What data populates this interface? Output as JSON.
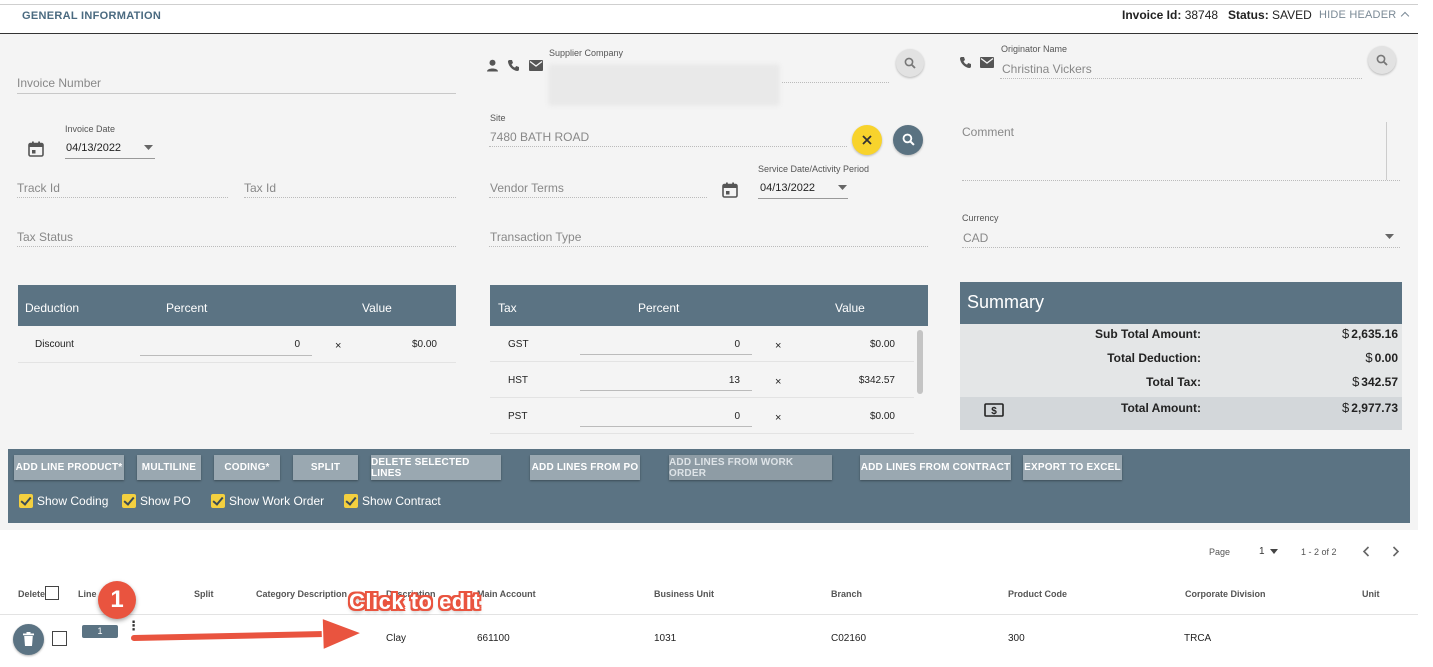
{
  "header": {
    "title": "GENERAL INFORMATION",
    "invoice_id_label": "Invoice Id",
    "invoice_id": "38748",
    "status_label": "Status",
    "status": "SAVED",
    "hide_header": "HIDE HEADER"
  },
  "form": {
    "invoice_number_label": "Invoice Number",
    "invoice_date_label": "Invoice Date",
    "invoice_date": "04/13/2022",
    "track_id_label": "Track Id",
    "tax_id_label": "Tax Id",
    "tax_status_label": "Tax Status",
    "supplier_company_label": "Supplier Company",
    "site_label": "Site",
    "site": "7480 BATH ROAD",
    "vendor_terms_label": "Vendor Terms",
    "service_date_label": "Service Date/Activity Period",
    "service_date": "04/13/2022",
    "transaction_type_label": "Transaction Type",
    "originator_name_label": "Originator Name",
    "originator_name": "Christina Vickers",
    "comment_label": "Comment",
    "currency_label": "Currency",
    "currency": "CAD"
  },
  "deduction_table": {
    "headers": [
      "Deduction",
      "Percent",
      "Value"
    ],
    "rows": [
      {
        "name": "Discount",
        "percent": "0",
        "value": "$0.00"
      }
    ]
  },
  "tax_table": {
    "headers": [
      "Tax",
      "Percent",
      "Value"
    ],
    "rows": [
      {
        "name": "GST",
        "percent": "0",
        "value": "$0.00"
      },
      {
        "name": "HST",
        "percent": "13",
        "value": "$342.57"
      },
      {
        "name": "PST",
        "percent": "0",
        "value": "$0.00"
      }
    ]
  },
  "summary": {
    "title": "Summary",
    "currency_symbol": "$",
    "rows": [
      {
        "label": "Sub Total Amount:",
        "value": "2,635.16"
      },
      {
        "label": "Total Deduction:",
        "value": "0.00"
      },
      {
        "label": "Total Tax:",
        "value": "342.57"
      },
      {
        "label": "Total Amount:",
        "value": "2,977.73"
      }
    ]
  },
  "toolbar": {
    "buttons": [
      "ADD LINE PRODUCT*",
      "MULTILINE",
      "CODING*",
      "SPLIT",
      "DELETE SELECTED LINES",
      "ADD LINES FROM PO",
      "ADD LINES FROM WORK ORDER",
      "ADD LINES FROM CONTRACT",
      "EXPORT TO EXCEL"
    ],
    "checkboxes": [
      "Show Coding",
      "Show PO",
      "Show Work Order",
      "Show Contract"
    ]
  },
  "pagination": {
    "page_label": "Page",
    "page": "1",
    "range": "1 - 2 of 2"
  },
  "grid": {
    "headers": [
      "Delete",
      "Line",
      "Split",
      "Category Description",
      "Description",
      "Main Account",
      "Business Unit",
      "Branch",
      "Product Code",
      "Corporate Division",
      "Unit"
    ],
    "row": {
      "line": "1",
      "description": "Clay",
      "main_account": "661100",
      "business_unit": "1031",
      "branch": "C02160",
      "product_code": "300",
      "corporate_division": "TRCA"
    }
  },
  "annotation": {
    "step": "1",
    "callout": "Click to edit"
  },
  "colors": {
    "slate": "#5b7383",
    "accent_red": "#e9543f",
    "yellow": "#f8d32c"
  }
}
